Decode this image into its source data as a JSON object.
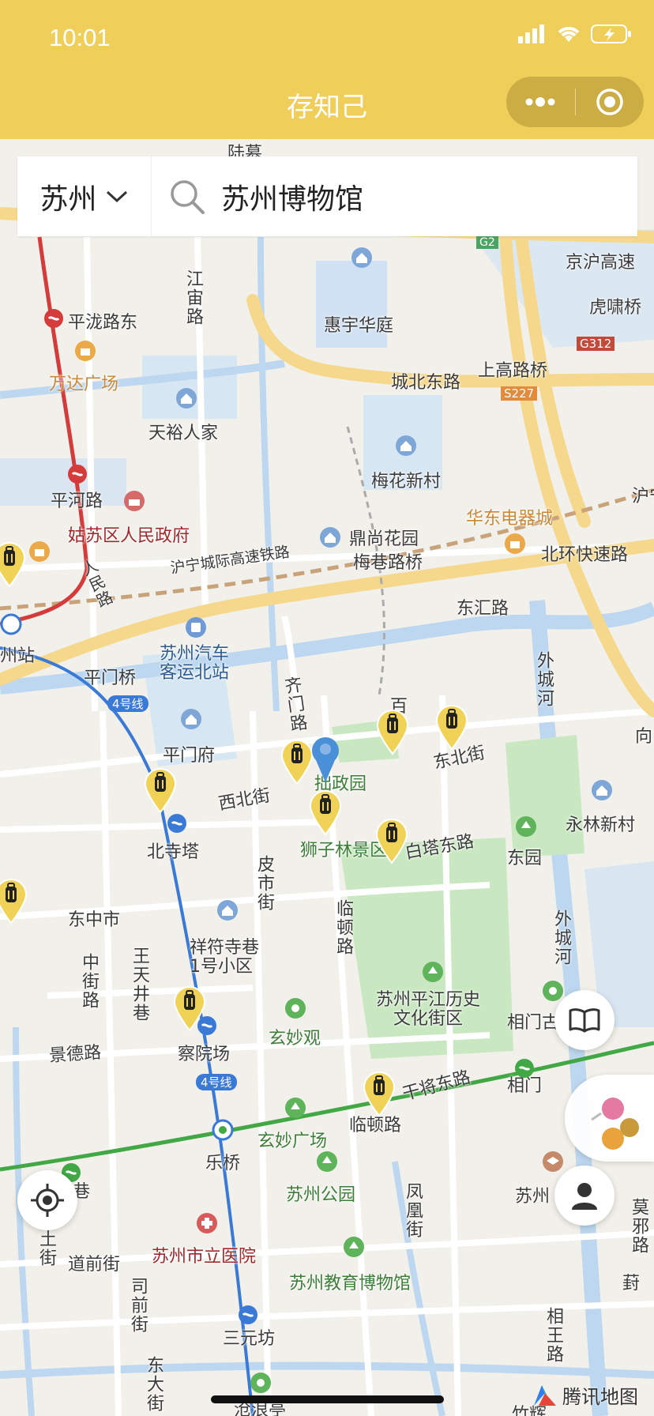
{
  "status_bar": {
    "time": "10:01"
  },
  "nav": {
    "title": "存知己"
  },
  "search": {
    "city": "苏州",
    "query": "苏州博物馆"
  },
  "map": {
    "provider_logo": "腾讯地图",
    "labels": {
      "luxu": "陆慕",
      "jiangyu_road": "江宙路",
      "pinglong_east": "平泷路东",
      "huiyu_huating": "惠宇华庭",
      "g2": "G2",
      "jinghu_expressway": "京沪高速",
      "huxiao_bridge": "虎啸桥",
      "wanda_plaza": "万达广场",
      "g312": "G312",
      "chengbei_east_road": "城北东路",
      "shanggao_bridge": "上高路桥",
      "s227": "S227",
      "tianyu_renjia": "天裕人家",
      "meihua_xincun": "梅花新村",
      "pinghe_road": "平河路",
      "gusu_gov": "姑苏区人民政府",
      "huadong_mall": "华东电器城",
      "hu_right": "沪宁",
      "dingshang_garden": "鼎尚花园",
      "huning_railway": "沪宁城际高速铁路",
      "meixiang_bridge": "梅巷路桥",
      "beihuan_expressway": "北环快速路",
      "renmin_road": "人民路",
      "donghui_road": "东汇路",
      "zhou_station": "州站",
      "pingmen_bridge": "平门桥",
      "bus_station": "苏州汽车\n客运北站",
      "waicheng_river_1": "外城河",
      "qimen_road": "齐门路",
      "bai": "百",
      "dongbei_street": "东北街",
      "xiang": "向",
      "line4": "4号线",
      "pingmen_fu": "平门府",
      "zhuozheng_garden": "拙政园",
      "xibei_street": "西北街",
      "yonglin_xincun": "永林新村",
      "beisi_pagoda": "北寺塔",
      "shizilin": "狮子林景区",
      "baita_east_road": "白塔东路",
      "dong_garden": "东园",
      "pishi_street": "皮市街",
      "dongzhong_market": "东中市",
      "lindun_road_v": "临顿路",
      "waicheng_river_2": "外城河",
      "xiangfu_lane": "祥符寺巷\n1号小区",
      "zhongjie_road": "中街路",
      "wangtian_lane": "王天井巷",
      "pingjiang_district": "苏州平江历史\n文化街区",
      "xiangmen_old": "相门古",
      "xuanmiao_temple": "玄妙观",
      "jingde_road": "景德路",
      "chayuan_chang": "察院场",
      "line4_b": "4号线",
      "ganjiang_east": "干将东路",
      "xiangmen": "相门",
      "lindun_road": "临顿路",
      "xuanmiao_plaza": "玄妙广场",
      "le_bridge": "乐桥",
      "xiang_lane": "香巷",
      "suzhou_park": "苏州公园",
      "fenghuang_street": "凤凰街",
      "suzhou_right": "苏州",
      "moxie_road": "莫邪路",
      "tu_street": "土街",
      "daoqian_street": "道前街",
      "city_hospital": "苏州市立医院",
      "edu_museum": "苏州教育博物馆",
      "feng": "葑",
      "siqian_street": "司前街",
      "sanyuan_fang": "三元坊",
      "xiangwang_road": "相王路",
      "dongda_street": "东大街",
      "canglang_pavilion": "沧浪亭",
      "zhu": "竹辉"
    }
  },
  "colors": {
    "accent_yellow": "#efcf5a",
    "road_yellow": "#f6d88c",
    "water": "#cfe1f3",
    "park": "#c9e8c1",
    "metro_red": "#d43b3b",
    "metro_blue": "#3a79d6",
    "metro_green": "#42a845",
    "pin_blue": "#4a90d9"
  },
  "icons": {
    "city_dropdown": "chevron-down-icon",
    "search": "search-icon",
    "more": "more-icon",
    "close_target": "target-icon",
    "book": "book-icon",
    "locate": "locate-icon",
    "profile": "person-icon",
    "locker_pin": "luggage-pin-icon"
  }
}
